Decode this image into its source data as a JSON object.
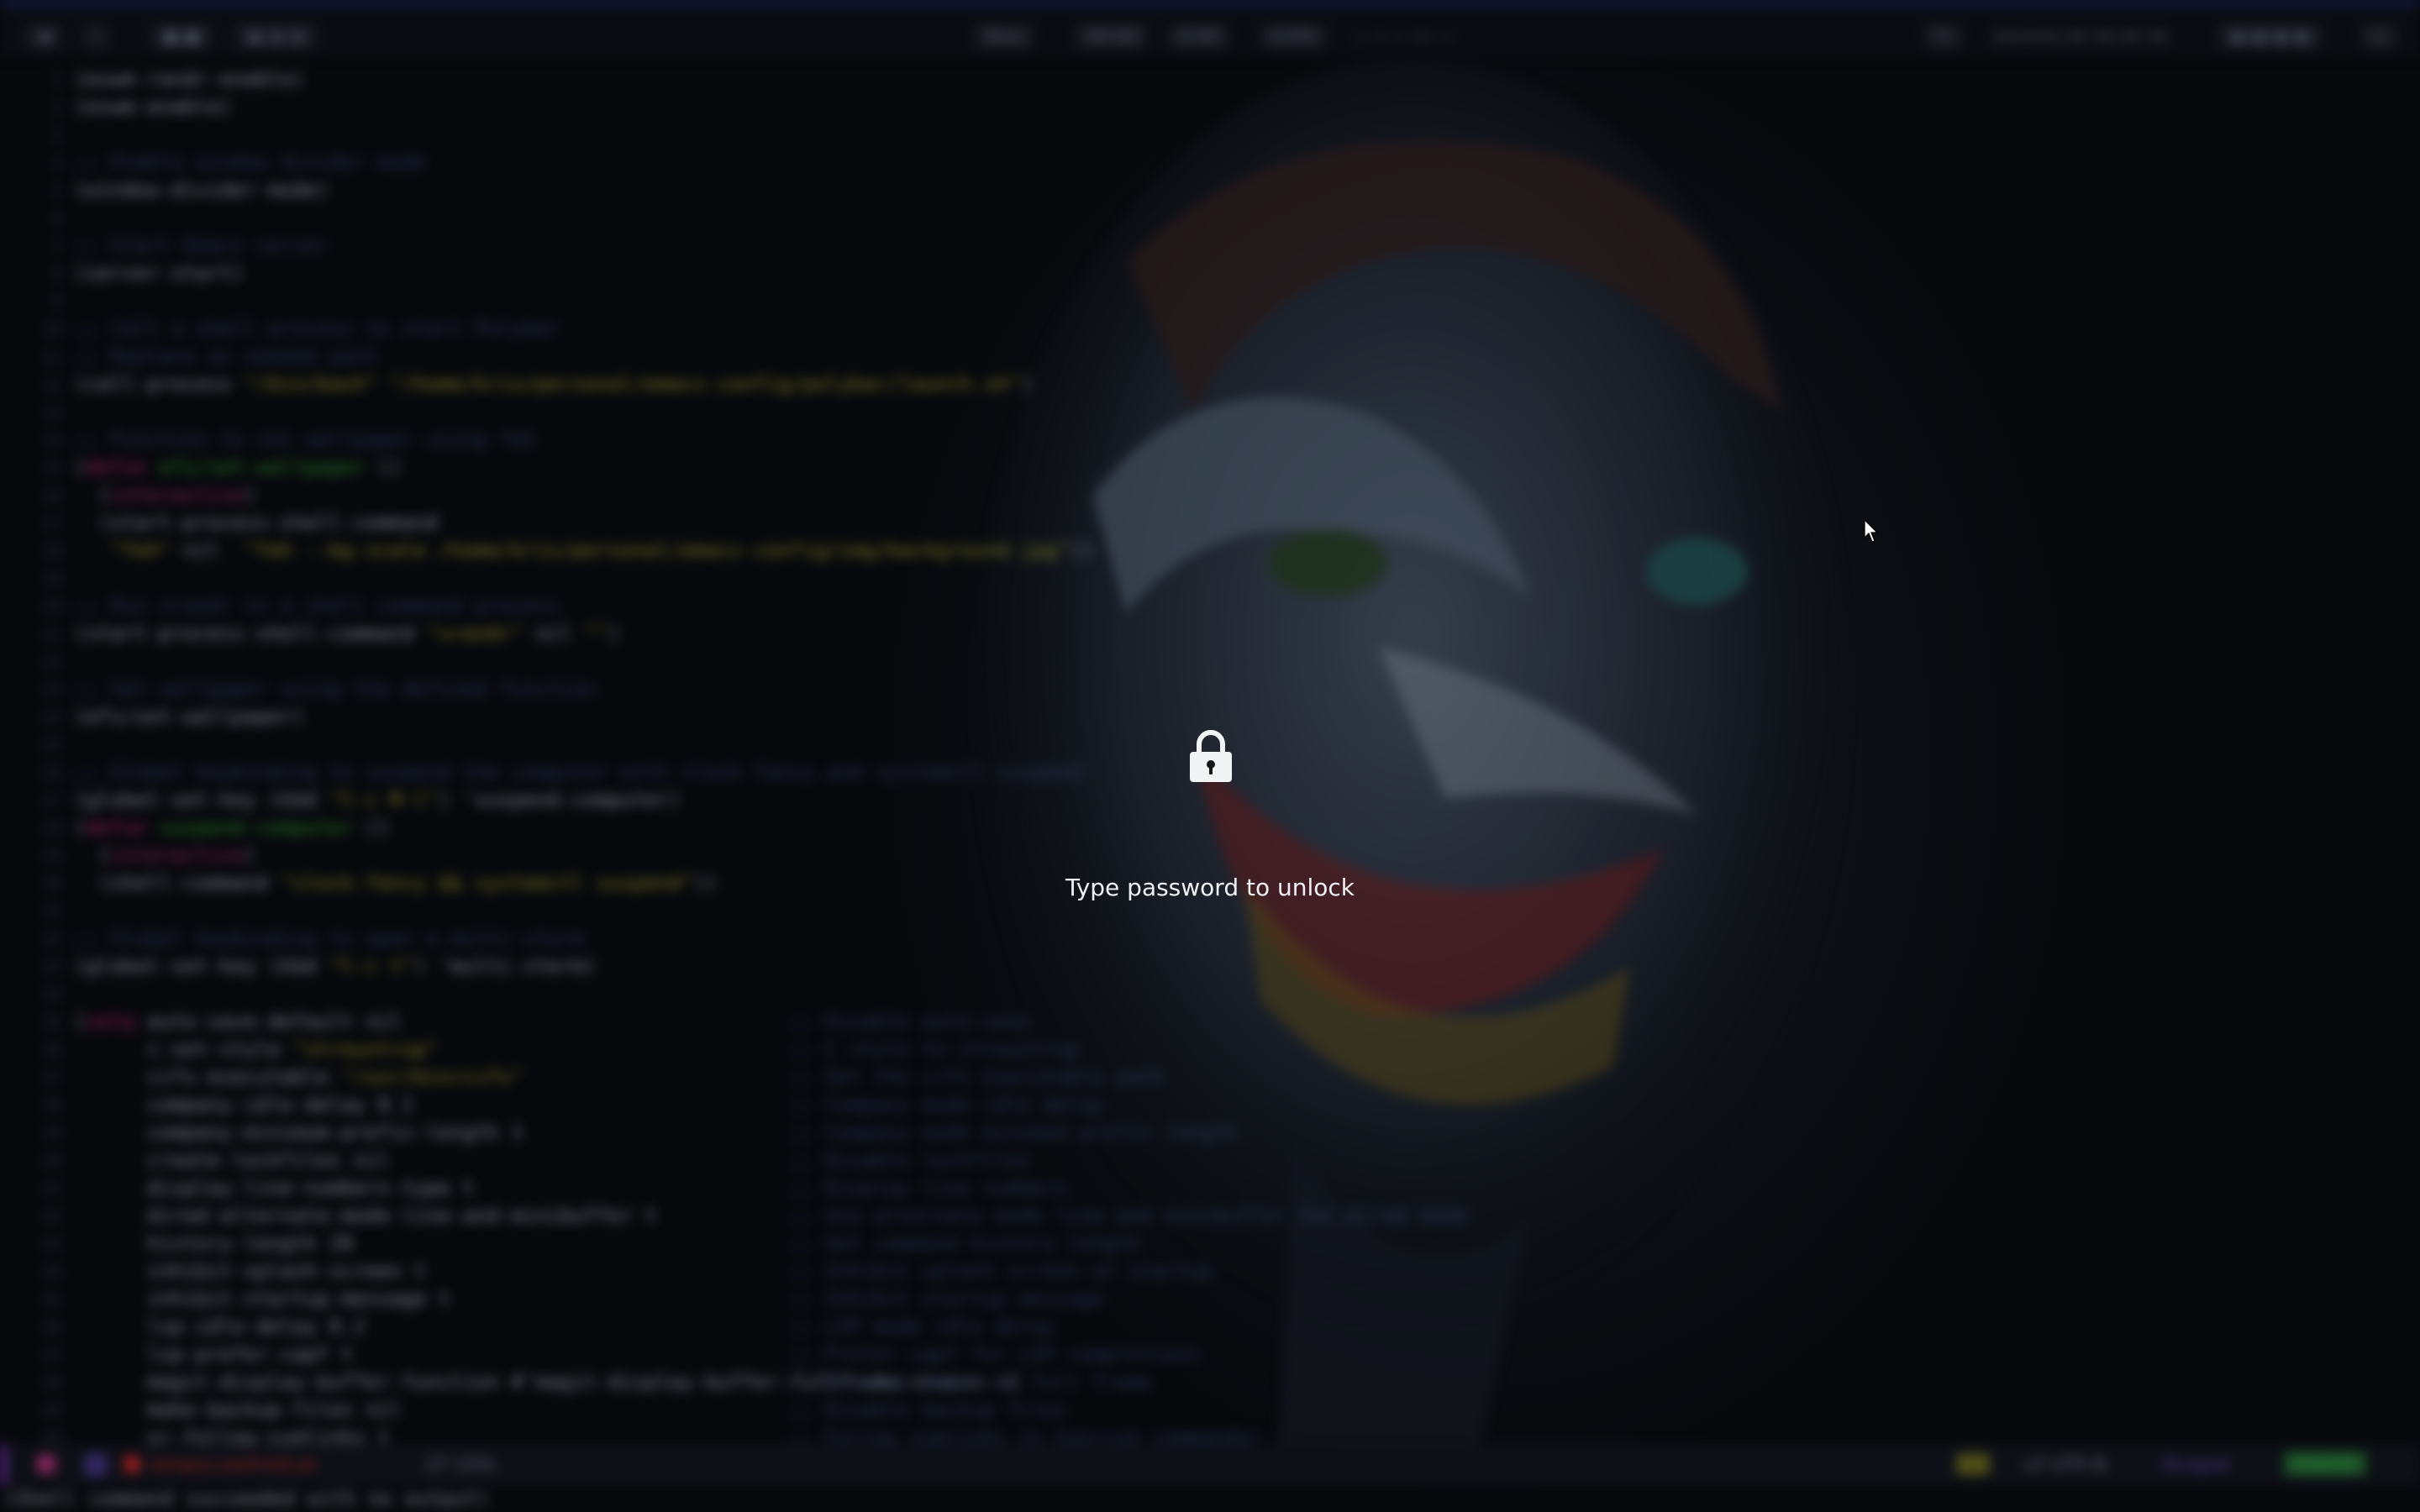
{
  "lock_screen": {
    "prompt": "Type password to unlock",
    "icon": "padlock-icon"
  },
  "topbar": {
    "center_items": [
      "Bios",
      "00:00",
      "0:00",
      "0.0%"
    ],
    "title": "— • — •• —",
    "clock": "2024/01/30 00:00 00"
  },
  "editor": {
    "lines": [
      {
        "n": "1",
        "html": "(exwm-randr-enable)"
      },
      {
        "n": "2",
        "html": "(exwm-enable)"
      },
      {
        "n": "3",
        "html": ""
      },
      {
        "n": "4",
        "html": "<span class='cm'>;; Enable window divider mode</span>"
      },
      {
        "n": "5",
        "html": "(window-divider-mode)"
      },
      {
        "n": "6",
        "html": ""
      },
      {
        "n": "7",
        "html": "<span class='cm'>;; Start Emacs server</span>"
      },
      {
        "n": "8",
        "html": "(server-start)"
      },
      {
        "n": "9",
        "html": ""
      },
      {
        "n": "10",
        "html": "<span class='cm'>;; Call a shell process to start Polybar</span>"
      },
      {
        "n": "11",
        "html": "<span class='cm'>;; Replace as needed path</span>"
      },
      {
        "n": "12",
        "html": "(call-process <span class='str'>\"/bin/bash\"</span> <span class='str'>\"/home/kris/personal/emacs-config/polybar/launch.sh\"</span>)"
      },
      {
        "n": "13",
        "html": ""
      },
      {
        "n": "14",
        "html": "<span class='cm'>;; Function to set wallpaper using feh</span>"
      },
      {
        "n": "15",
        "html": "(<span class='kw'>defun</span> <span class='fn'>efs/set-wallpaper</span> ()"
      },
      {
        "n": "16",
        "html": "  (<span class='sym'>interactive</span>)"
      },
      {
        "n": "17",
        "html": "  (start-process-shell-command"
      },
      {
        "n": "18",
        "html": "   <span class='str'>\"feh\"</span> nil  <span class='str'>\"feh --bg-scale /home/kris/personal/emacs-config/img/background.jpg\"</span>))"
      },
      {
        "n": "19",
        "html": ""
      },
      {
        "n": "20",
        "html": "<span class='cm'>;; Run xrandr in a shell command process</span>"
      },
      {
        "n": "21",
        "html": "(start-process-shell-command <span class='str'>\"xrandr\"</span> nil <span class='str'>\"\"</span>)"
      },
      {
        "n": "22",
        "html": ""
      },
      {
        "n": "23",
        "html": "<span class='cm'>;; Set wallpaper using the defined function</span>"
      },
      {
        "n": "24",
        "html": "(efs/set-wallpaper)"
      },
      {
        "n": "25",
        "html": ""
      },
      {
        "n": "26",
        "html": "<span class='cm'>;; Global keybinding to suspend the computer with slock fancy and systemctl suspend</span>"
      },
      {
        "n": "27",
        "html": "(global-set-key (kbd <span class='str'>\"C-c M-l\"</span>) 'suspend-computer)"
      },
      {
        "n": "28",
        "html": "(<span class='kw'>defun</span> <span class='fn'>suspend-computer</span> ()"
      },
      {
        "n": "29",
        "html": "  (<span class='sym'>interactive</span>)"
      },
      {
        "n": "30",
        "html": "  (shell-command <span class='str'>\"slock-fancy && systemctl suspend\"</span>))"
      },
      {
        "n": "31",
        "html": ""
      },
      {
        "n": "32",
        "html": "<span class='cm'>;; Global keybinding to open a multi-vterm</span>"
      },
      {
        "n": "33",
        "html": "(global-set-key (kbd <span class='str'>\"C-c t\"</span>) 'multi-vterm)"
      },
      {
        "n": "34",
        "html": ""
      },
      {
        "n": "35",
        "html": "(<span class='kw'>setq</span> auto-save-default nil"
      },
      {
        "n": "36",
        "html": "      c-set-style <span class='str'>\"stroustrup\"</span>"
      },
      {
        "n": "37",
        "html": "      cifs-executable <span class='str'>\"/usr/bin/cifs\"</span>"
      },
      {
        "n": "38",
        "html": "      company-idle-delay 0.1"
      },
      {
        "n": "39",
        "html": "      company-minimum-prefix-length 1"
      },
      {
        "n": "40",
        "html": "      create-lockfiles nil"
      },
      {
        "n": "41",
        "html": "      display-line-numbers-type t"
      },
      {
        "n": "42",
        "html": "      dired-alternate-mode-line-and-minibuffer t"
      },
      {
        "n": "43",
        "html": "      history-length 20"
      },
      {
        "n": "44",
        "html": "      inhibit-splash-screen t"
      },
      {
        "n": "45",
        "html": "      inhibit-startup-message t"
      },
      {
        "n": "46",
        "html": "      lsp-idle-delay 0.2"
      },
      {
        "n": "47",
        "html": "      lsp-prefer-capf t"
      },
      {
        "n": "48",
        "html": "      magit-display-buffer-function #'magit-display-buffer-fullframe-status-v1"
      },
      {
        "n": "49",
        "html": "      make-backup-files nil"
      },
      {
        "n": "50",
        "html": "      sr-follow-symlinks t"
      }
    ],
    "side_comments": [
      ";; Disable auto-save",
      ";; C style to stroustrup",
      ";; Set the cifs executable path",
      ";; Company mode idle delay",
      ";; Company mode minimum prefix length",
      ";; Disable lockfiles",
      ";; Display line numbers",
      ";; Use alternate mode line and minibuffer for dired mode",
      ";; Set command history length",
      ";; Inhibit splash screen at startup",
      ";; Inhibit startup message",
      ";; LSP mode idle delay",
      ";; Prefer capf for LSP completions",
      ";; Display magit in full frame",
      ";; Disable backup files",
      ";; Follow symlinks in Sunrise commander"
    ]
  },
  "modeline": {
    "buffer": "emacs-conf-init.el",
    "position": "27 15%",
    "right_position": "LF UTF-8",
    "mode": "ELisp/d",
    "vcs": "master"
  },
  "echo_area": "(Shell command succeeded with no output)"
}
